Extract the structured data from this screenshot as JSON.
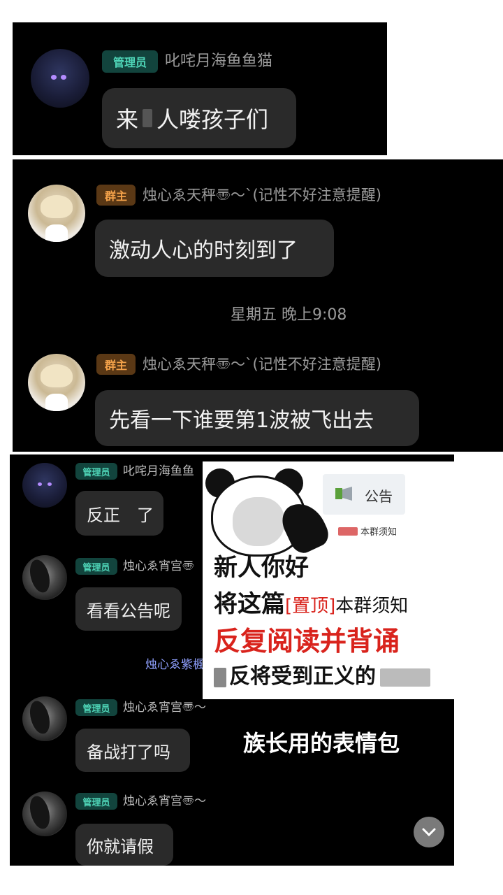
{
  "panel1": {
    "message": {
      "badge": "管理员",
      "sender": "叱咤月海鱼鱼猫",
      "text_part1": "来",
      "text_part2": "人喽孩子们"
    }
  },
  "panel2": {
    "messages": [
      {
        "badge": "群主",
        "sender": "烛心ゑ天秤〠～`(记性不好注意提醒)",
        "text": "激动人心的时刻到了"
      },
      {
        "badge": "群主",
        "sender": "烛心ゑ天秤〠～`(记性不好注意提醒)",
        "text": "先看一下谁要第1波被飞出去"
      }
    ],
    "timestamp": "星期五 晚上9:08"
  },
  "panel3": {
    "messages": [
      {
        "badge": "管理员",
        "sender": "叱咤月海鱼鱼",
        "text": "反正　了"
      },
      {
        "badge": "管理员",
        "sender": "烛心ゑ宵宫〠",
        "text": "看看公告呢"
      },
      {
        "badge": "管理员",
        "sender": "烛心ゑ宵宫〠～",
        "text": "备战打了吗"
      },
      {
        "badge": "管理员",
        "sender": "烛心ゑ宵宫〠～",
        "text": "你就请假"
      }
    ],
    "mention": "烛心ゑ紫楓",
    "meme": {
      "notice_label": "公告",
      "notice_sub": "本群须知",
      "line1": "新人你好",
      "line2_a": "将这篇",
      "line2_b": "[置顶]",
      "line2_c": "本群须知",
      "line3": "反复阅读并背诵",
      "line4": "反将受到正义的"
    },
    "caption": "族长用的表情包",
    "scroll_icon": "chevron-down-icon"
  },
  "colors": {
    "admin_badge_text": "#4fd6b8",
    "owner_badge_text": "#f4a24a",
    "bubble": "#2a2a2a",
    "meme_red": "#d9231c"
  }
}
